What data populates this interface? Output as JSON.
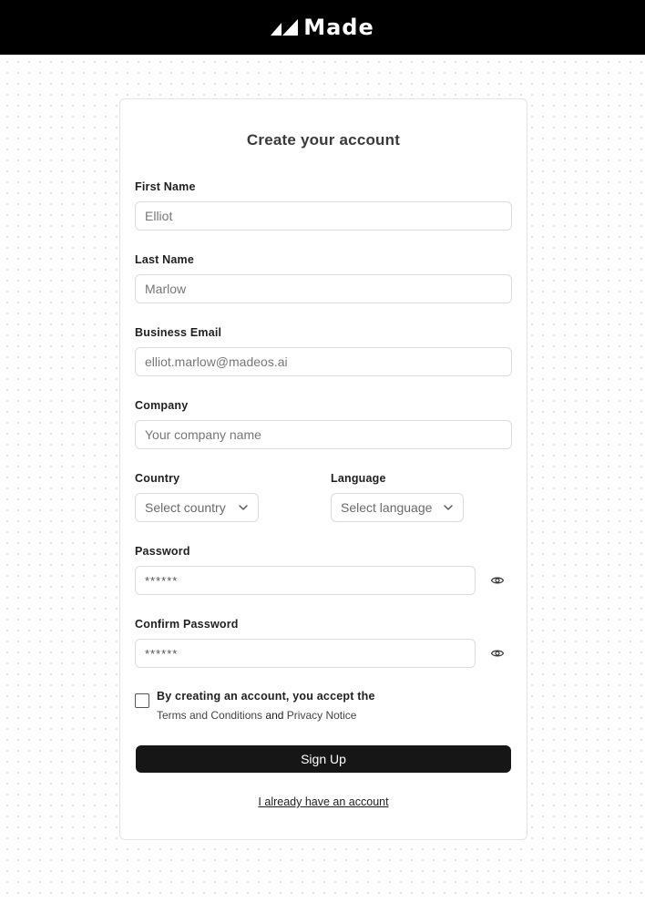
{
  "header": {
    "brand_name": "Made",
    "brand_icon": "made-logo-icon",
    "background": "#000000"
  },
  "form": {
    "title": "Create your account",
    "first_name": {
      "label": "First Name",
      "placeholder": "Elliot"
    },
    "last_name": {
      "label": "Last Name",
      "placeholder": "Marlow"
    },
    "email": {
      "label": "Business Email",
      "placeholder": "elliot.marlow@madeos.ai"
    },
    "company": {
      "label": "Company",
      "placeholder": "Your company name"
    },
    "country": {
      "label": "Country",
      "selected": "Select country",
      "icon": "chevron-down-icon"
    },
    "language": {
      "label": "Language",
      "selected": "Select language",
      "icon": "chevron-down-icon"
    },
    "password": {
      "label": "Password",
      "placeholder": "******",
      "icon": "eye-icon"
    },
    "confirm_password": {
      "label": "Confirm Password",
      "placeholder": "******",
      "icon": "eye-icon"
    },
    "consent": {
      "text": "By creating an account, you accept the",
      "terms_link": "Terms and Conditions",
      "conjunction": "and",
      "privacy_link": "Privacy Notice",
      "checked": false
    },
    "submit_label": "Sign Up",
    "login_link": "I already have an account"
  },
  "colors": {
    "primary_button": "#161616",
    "border": "#dcdce0",
    "dot_pattern": "#d9d9d9"
  }
}
